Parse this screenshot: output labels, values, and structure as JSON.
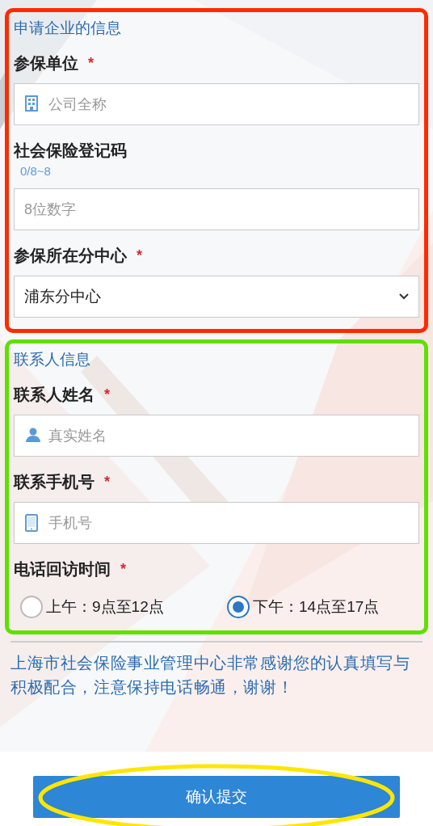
{
  "sections": [
    {
      "title": "申请企业的信息",
      "color": "#ff2a00",
      "fields": [
        {
          "kind": "text",
          "label": "参保单位",
          "required": true,
          "placeholder": "公司全称"
        },
        {
          "kind": "text",
          "label": "社会保险登记码",
          "required": false,
          "counter": "0/8~8",
          "placeholder": "8位数字"
        },
        {
          "kind": "select",
          "label": "参保所在分中心",
          "required": true,
          "value": "浦东分中心"
        }
      ]
    },
    {
      "title": "联系人信息",
      "color": "#5ee000",
      "fields": [
        {
          "kind": "text",
          "label": "联系人姓名",
          "required": true,
          "placeholder": "真实姓名"
        },
        {
          "kind": "text",
          "label": "联系手机号",
          "required": true,
          "placeholder": "手机号"
        },
        {
          "kind": "radio",
          "label": "电话回访时间",
          "required": true,
          "options": [
            {
              "label": "上午：9点至12点",
              "selected": false
            },
            {
              "label": "下午：14点至17点",
              "selected": true
            }
          ]
        }
      ]
    }
  ],
  "required_mark": "*",
  "notice": "上海市社会保险事业管理中心非常感谢您的认真填写与积极配合，注意保持电话畅通，谢谢！",
  "submit": {
    "label": "确认提交",
    "color": "#ffe600"
  }
}
